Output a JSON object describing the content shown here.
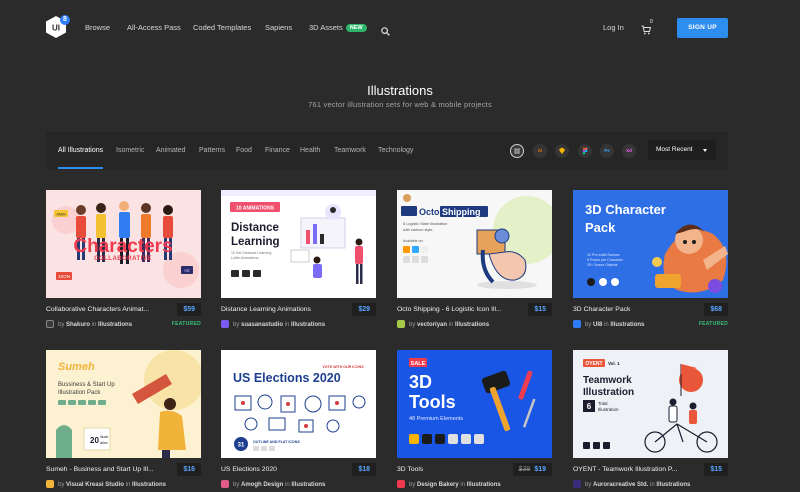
{
  "nav": {
    "logo_text": "UI",
    "logo_badge": "8",
    "links": [
      "Browse",
      "All-Access Pass",
      "Coded Templates",
      "Sapiens",
      "3D Assets"
    ],
    "new_badge": "NEW",
    "login": "Log In",
    "cart_count": "0",
    "signup": "SIGN UP"
  },
  "hero": {
    "title": "Illustrations",
    "subtitle": "761 vector illustration sets for web & mobile projects"
  },
  "filters": {
    "categories": [
      "All Illustrations",
      "Isometric",
      "Animated",
      "Patterns",
      "Food",
      "Finance",
      "Health",
      "Teamwork",
      "Technology"
    ],
    "active": "All Illustrations",
    "formats": [
      "grid",
      "Ai",
      "Sketch",
      "Figma",
      "Ps",
      "Xd"
    ],
    "format_labels": {
      "ai": "Ai",
      "ps": "Ps",
      "xd": "Xd"
    },
    "sort_label": "Most Recent"
  },
  "colors": {
    "accent": "#2e8ef0",
    "price": "#5aa6ff",
    "featured": "#36c07a"
  },
  "cards": [
    {
      "title": "Collaborative Characters Animat...",
      "price": "$59",
      "author": "Shakuro",
      "category": "Illustrations",
      "featured": "FEATURED",
      "thumb_text": [
        "Characters",
        "COLLABORATIVE",
        "JSON",
        "AE",
        "ANIM"
      ]
    },
    {
      "title": "Distance Learning Animations",
      "price": "$29",
      "author": "suasanastudio",
      "category": "Illustrations",
      "featured": "",
      "thumb_text": [
        "10 ANIMATIONS",
        "Distance",
        "Learning",
        "10 Set Distance Learning",
        "Lottie Animations"
      ]
    },
    {
      "title": "Octo Shipping - 6 Logistic Icon Ill...",
      "price": "$15",
      "author": "vectoriyan",
      "category": "Illustrations",
      "featured": "",
      "thumb_text": [
        "Octo",
        "Shipping",
        "6 Logistic State Illustration",
        "with cartoon style.",
        "Available on:"
      ]
    },
    {
      "title": "3D Character Pack",
      "price": "$68",
      "author": "UI8",
      "category": "Illustrations",
      "featured": "FEATURED",
      "thumb_text": [
        "3D Character",
        "Pack",
        "10 Pre-build Scenes",
        "9 Poses per Character",
        "20+ Scene Objects"
      ]
    },
    {
      "title": "Sumeh - Business and Start Up Ill...",
      "price": "$16",
      "author": "Visual Kreasi Studio",
      "category": "Illustrations",
      "featured": "",
      "thumb_text": [
        "Sumeh",
        "Bussiness & Start Up",
        "Illustration Pack",
        "20",
        "Illustr",
        "ation"
      ]
    },
    {
      "title": "US Elections 2020",
      "price": "$18",
      "author": "Amogh Design",
      "category": "Illustrations",
      "featured": "",
      "thumb_text": [
        "US Elections 2020",
        "VOTE WITH OUR ICONS",
        "31",
        "OUTLINE AND FLAT ICONS"
      ]
    },
    {
      "title": "3D Tools",
      "price": "$19",
      "old_price": "$39",
      "author": "Design Bakery",
      "category": "Illustrations",
      "featured": "",
      "thumb_text": [
        "SALE",
        "3D",
        "Tools",
        "48 Premium Elements"
      ]
    },
    {
      "title": "OYENT - Teamwork Illustration P...",
      "price": "$15",
      "author": "Auroracreative Std.",
      "category": "Illustrations",
      "featured": "",
      "thumb_text": [
        "OYENT",
        "Vol. 1",
        "Teamwork",
        "Illustration",
        "6",
        "Total",
        "Illustration"
      ]
    }
  ],
  "by_word": "by",
  "in_word": "in"
}
